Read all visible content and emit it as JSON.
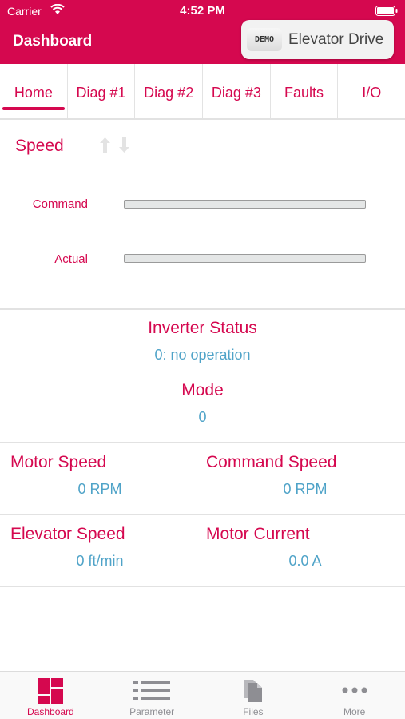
{
  "status_bar": {
    "carrier": "Carrier",
    "time": "4:52 PM"
  },
  "nav": {
    "title": "Dashboard",
    "demo_badge": "DEMO",
    "device_name": "Elevator Drive"
  },
  "tabs": [
    {
      "label": "Home",
      "active": true
    },
    {
      "label": "Diag #1"
    },
    {
      "label": "Diag #2"
    },
    {
      "label": "Diag #3"
    },
    {
      "label": "Faults"
    },
    {
      "label": "I/O"
    }
  ],
  "speed": {
    "title": "Speed",
    "icons": [
      "arrow-up-icon",
      "arrow-down-icon"
    ],
    "command": {
      "label": "Command",
      "level": 0
    },
    "actual": {
      "label": "Actual",
      "level": 0
    }
  },
  "inverter_status": {
    "title": "Inverter Status",
    "value": "0: no operation"
  },
  "mode": {
    "title": "Mode",
    "value": "0"
  },
  "metrics": {
    "motor_speed": {
      "title": "Motor Speed",
      "value": "0 RPM"
    },
    "command_speed": {
      "title": "Command Speed",
      "value": "0 RPM"
    },
    "elevator_speed": {
      "title": "Elevator Speed",
      "value": "0 ft/min"
    },
    "motor_current": {
      "title": "Motor Current",
      "value": "0.0 A"
    }
  },
  "tabbar": [
    {
      "label": "Dashboard",
      "icon": "dashboard-icon",
      "active": true
    },
    {
      "label": "Parameter",
      "icon": "list-icon"
    },
    {
      "label": "Files",
      "icon": "files-icon"
    },
    {
      "label": "More",
      "icon": "more-icon"
    }
  ],
  "colors": {
    "accent": "#d5084f",
    "value": "#4fa3c8",
    "inactive": "#8e8e93"
  }
}
